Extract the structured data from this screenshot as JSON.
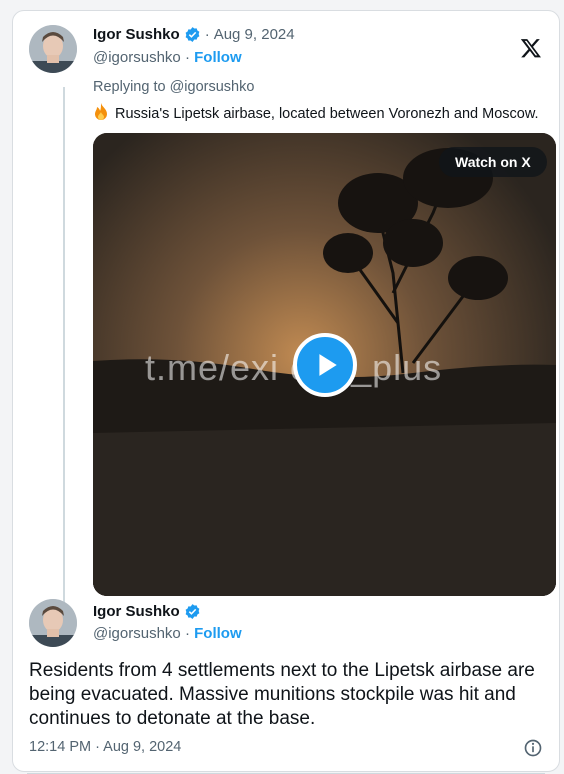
{
  "tweet1": {
    "name": "Igor Sushko",
    "date": "Aug 9, 2024",
    "handle": "@igorsushko",
    "follow_label": "Follow",
    "reply_to": "Replying to @igorsushko",
    "text": "Russia's Lipetsk airbase, located between Voronezh and Moscow.",
    "media": {
      "watermark": "t.me/exi    ova_plus",
      "watch_label": "Watch on X"
    }
  },
  "tweet2": {
    "name": "Igor Sushko",
    "handle": "@igorsushko",
    "follow_label": "Follow",
    "text": "Residents from 4 settlements next to the Lipetsk airbase are being evacuated. Massive munitions stockpile was hit and continues to detonate at the base.",
    "timestamp": "12:14 PM · Aug 9, 2024"
  },
  "colors": {
    "accent": "#1d9bf0",
    "muted": "#536471",
    "text": "#0f1419"
  },
  "icons": [
    "verified-badge-icon",
    "x-logo-icon",
    "fire-emoji-icon",
    "play-icon",
    "info-icon"
  ]
}
